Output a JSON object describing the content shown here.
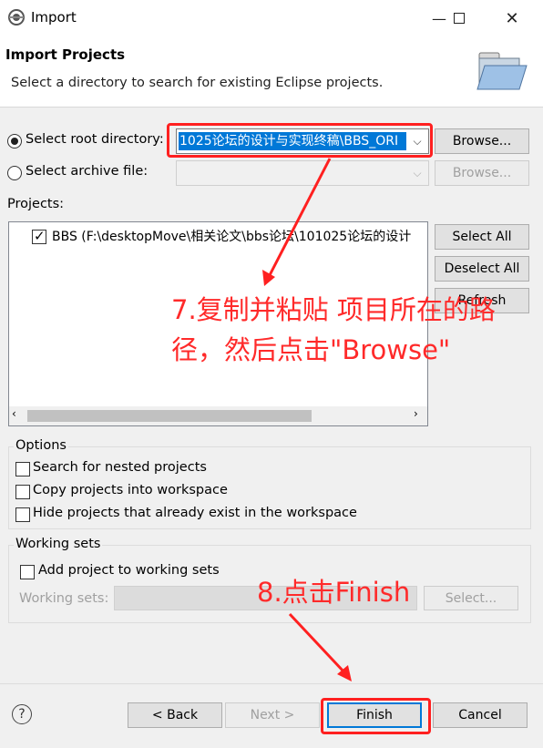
{
  "window": {
    "title": "Import",
    "minimize_icon": "minimize-icon",
    "maximize_icon": "maximize-icon",
    "close_icon": "close-icon"
  },
  "header": {
    "title": "Import Projects",
    "description": "Select a directory to search for existing Eclipse projects.",
    "icon": "folder-open-icon"
  },
  "source": {
    "root_dir_label": "Select root directory:",
    "root_dir_value": "1025论坛的设计与实现终稿\\BBS_ORI",
    "archive_label": "Select archive file:",
    "archive_value": "",
    "browse_label": "Browse...",
    "browse2_label": "Browse..."
  },
  "projects": {
    "label": "Projects:",
    "items": [
      {
        "label": "BBS (F:\\desktopMove\\相关论文\\bbs论坛\\101025论坛的设计",
        "checked": true
      }
    ],
    "select_all": "Select All",
    "deselect_all": "Deselect All",
    "refresh": "Refresh"
  },
  "options": {
    "legend": "Options",
    "nested": "Search for nested projects",
    "copy": "Copy projects into workspace",
    "hide": "Hide projects that already exist in the workspace"
  },
  "working_sets": {
    "legend": "Working sets",
    "add": "Add project to working sets",
    "sets_label": "Working sets:",
    "select_label": "Select..."
  },
  "footer": {
    "help_icon": "help-icon",
    "back": "< Back",
    "next": "Next >",
    "finish": "Finish",
    "cancel": "Cancel"
  },
  "annotations": {
    "step7": "7.复制并粘贴 项目所在的路径，然后点击\"Browse\"",
    "step8": "8.点击Finish",
    "color": "#ff2020"
  }
}
